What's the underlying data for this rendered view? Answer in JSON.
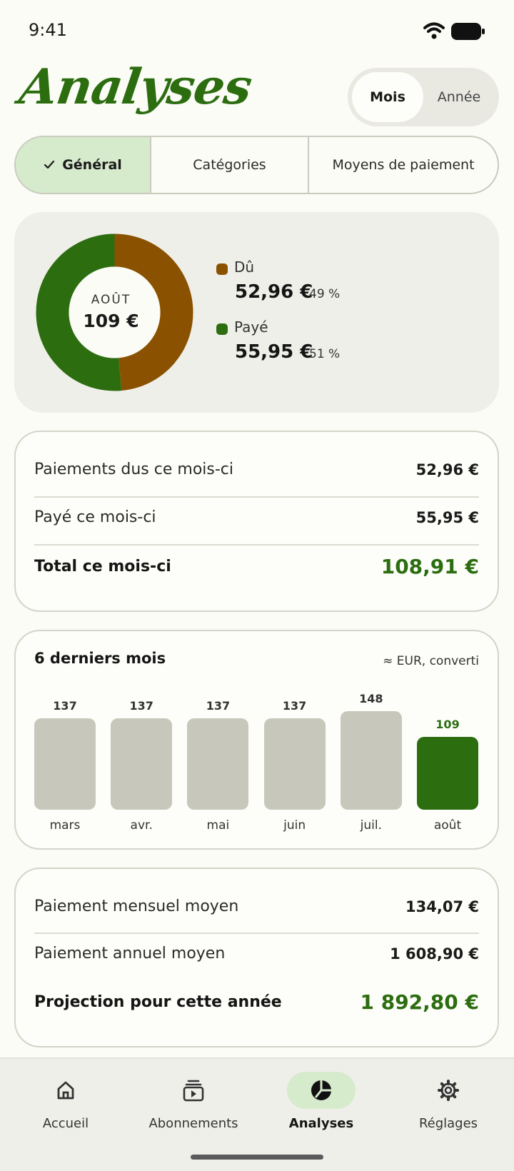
{
  "status": {
    "time": "9:41"
  },
  "header": {
    "title": "Analyses",
    "toggle": {
      "mois": "Mois",
      "annee": "Année"
    }
  },
  "tabs": {
    "general": "Général",
    "categories": "Catégories",
    "moyens": "Moyens de paiement"
  },
  "donut": {
    "month": "AOÛT",
    "total": "109 €",
    "slices": [
      {
        "label": "Dû",
        "value": "52,96 €",
        "pct": "49 %",
        "fraction": 0.486,
        "color": "#8a5200"
      },
      {
        "label": "Payé",
        "value": "55,95 €",
        "pct": "51 %",
        "fraction": 0.514,
        "color": "#2c6d10"
      }
    ]
  },
  "summary": {
    "due_label": "Paiements dus ce mois-ci",
    "due_value": "52,96 €",
    "paid_label": "Payé ce mois-ci",
    "paid_value": "55,95 €",
    "total_label": "Total ce mois-ci",
    "total_value": "108,91 €"
  },
  "chart_data": {
    "type": "bar",
    "title": "6 derniers mois",
    "note": "≈ EUR, converti",
    "categories": [
      "mars",
      "avr.",
      "mai",
      "juin",
      "juil.",
      "août"
    ],
    "values": [
      137,
      137,
      137,
      137,
      148,
      109
    ],
    "colors": [
      "#c7c8bb",
      "#c7c8bb",
      "#c7c8bb",
      "#c7c8bb",
      "#c7c8bb",
      "#2c6d10"
    ],
    "highlight_value_color": "#2c6d10"
  },
  "averages": {
    "monthly_label": "Paiement mensuel moyen",
    "monthly_value": "134,07 €",
    "annual_label": "Paiement annuel moyen",
    "annual_value": "1 608,90 €",
    "projection_label": "Projection pour cette année",
    "projection_value": "1 892,80 €"
  },
  "nav": {
    "accueil": "Accueil",
    "abonnements": "Abonnements",
    "analyses": "Analyses",
    "reglages": "Réglages"
  },
  "colors": {
    "accent": "#2c6d10",
    "due": "#8a5200",
    "background": "#FBFCF5"
  }
}
